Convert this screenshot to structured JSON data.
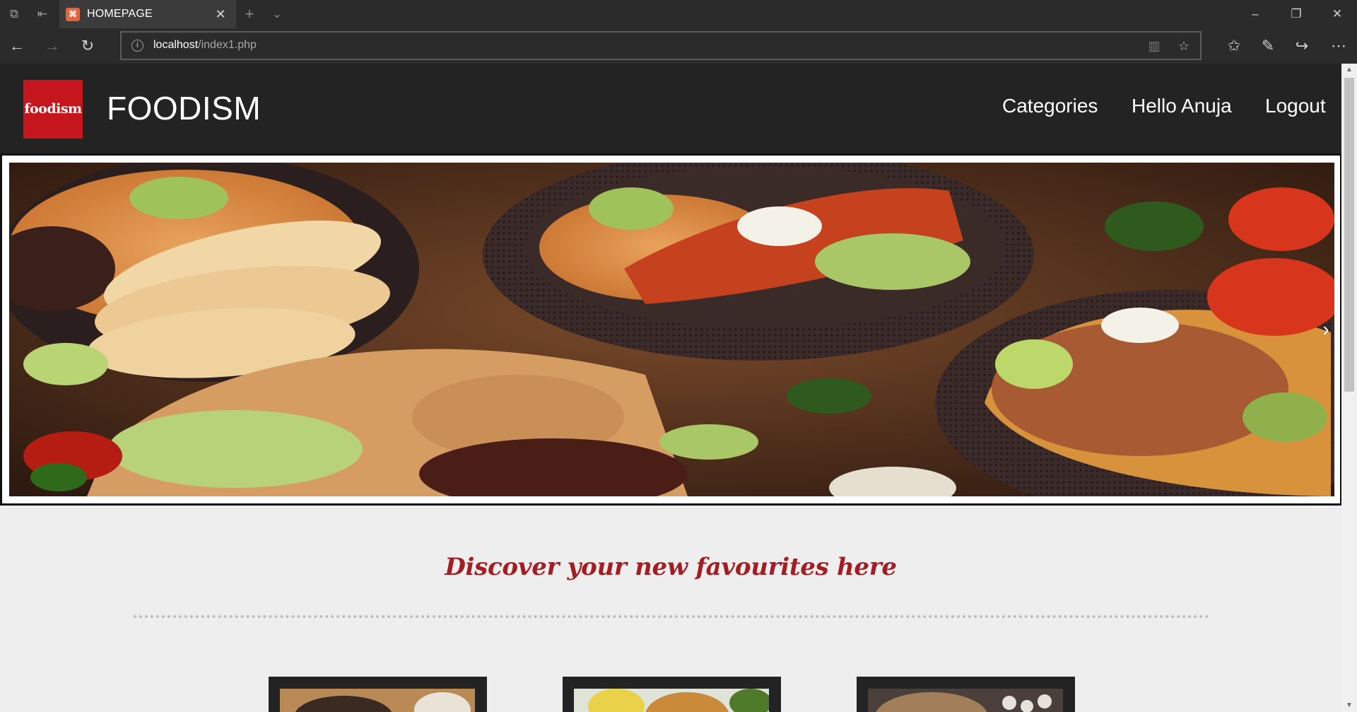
{
  "browser": {
    "tab": {
      "title": "HOMEPAGE"
    },
    "address": {
      "host": "localhost",
      "path": "/index1.php"
    }
  },
  "site": {
    "logo_text": "foodism",
    "brand": "FOODISM",
    "nav": [
      {
        "label": "Categories"
      },
      {
        "label": "Hello Anuja"
      },
      {
        "label": "Logout"
      }
    ],
    "slider": {
      "next_label": "›"
    },
    "tagline": "Discover your new favourites here",
    "cards_count": 3
  },
  "colors": {
    "chrome": "#2b2b2b",
    "header_bg": "#232323",
    "logo_bg": "#c4161c",
    "tagline": "#a31e23",
    "page_bg": "#eeeeee"
  },
  "icons": {
    "tab_actions": [
      "tabs-aside-icon",
      "set-aside-icon"
    ],
    "tab_bar": [
      "new-tab-icon",
      "tab-preview-icon"
    ],
    "window": [
      "minimize-icon",
      "restore-icon",
      "close-icon"
    ],
    "nav": [
      "back-icon",
      "forward-icon",
      "refresh-icon"
    ],
    "address": [
      "info-icon",
      "reading-view-icon",
      "favorite-star-icon"
    ],
    "toolbar": [
      "favorites-hub-icon",
      "web-note-icon",
      "share-icon",
      "more-icon"
    ]
  }
}
